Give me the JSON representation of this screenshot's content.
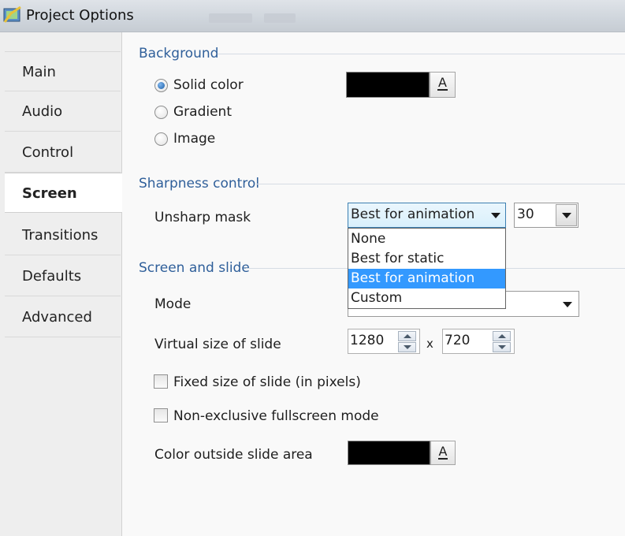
{
  "window": {
    "title": "Project Options"
  },
  "sidebar": {
    "items": [
      {
        "label": "Main"
      },
      {
        "label": "Audio"
      },
      {
        "label": "Control"
      },
      {
        "label": "Screen",
        "active": true
      },
      {
        "label": "Transitions"
      },
      {
        "label": "Defaults"
      },
      {
        "label": "Advanced"
      }
    ]
  },
  "background": {
    "title": "Background",
    "options": [
      "Solid color",
      "Gradient",
      "Image"
    ],
    "selected": "Solid color",
    "color": "#000000",
    "color_button_label": "A"
  },
  "sharpness": {
    "title": "Sharpness control",
    "unsharp_label": "Unsharp mask",
    "selected_value": "Best for animation",
    "options": [
      "None",
      "Best for static",
      "Best for animation",
      "Custom"
    ],
    "amount_value": "30"
  },
  "screen_slide": {
    "title": "Screen and slide",
    "mode_label": "Mode",
    "virtual_size_label": "Virtual size of slide",
    "width_value": "1280",
    "separator": "x",
    "height_value": "720",
    "fixed_size_label": "Fixed size of slide (in pixels)",
    "fixed_size_checked": false,
    "non_exclusive_label": "Non-exclusive fullscreen mode",
    "non_exclusive_checked": false,
    "outside_color_label": "Color outside slide area",
    "outside_color": "#000000",
    "color_button_label": "A"
  },
  "colors": {
    "accent": "#2f5f9a",
    "highlight": "#3399ff"
  }
}
